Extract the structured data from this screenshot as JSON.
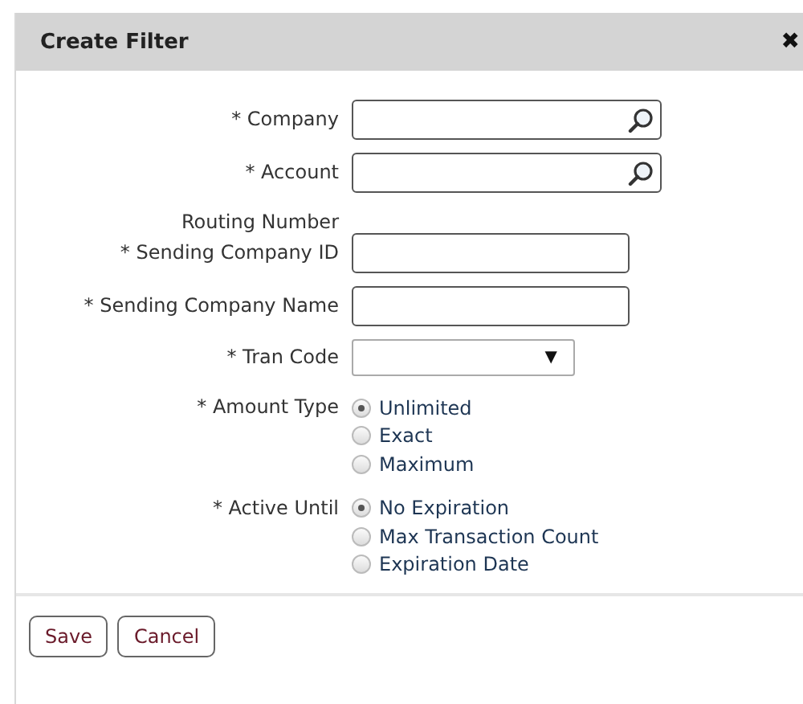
{
  "dialog": {
    "title": "Create Filter",
    "close": "✖"
  },
  "fields": [
    {
      "kind": "lookup",
      "label": "* Company"
    },
    {
      "kind": "lookup",
      "label": "* Account"
    },
    {
      "kind": "label",
      "label": "Routing Number"
    },
    {
      "kind": "text",
      "label": "* Sending Company ID"
    },
    {
      "kind": "text",
      "label": "* Sending Company Name"
    },
    {
      "kind": "select",
      "label": "* Tran Code",
      "arrow": "▼"
    },
    {
      "kind": "radio",
      "label": "* Amount Type",
      "options": [
        {
          "label": "Unlimited",
          "selected": true
        },
        {
          "label": "Exact",
          "selected": false
        },
        {
          "label": "Maximum",
          "selected": false
        }
      ]
    },
    {
      "kind": "radio",
      "label": "* Active Until",
      "options": [
        {
          "label": "No Expiration",
          "selected": true
        },
        {
          "label": "Max Transaction Count",
          "selected": false
        },
        {
          "label": "Expiration Date",
          "selected": false
        }
      ]
    }
  ],
  "buttons": [
    "Save",
    "Cancel"
  ]
}
